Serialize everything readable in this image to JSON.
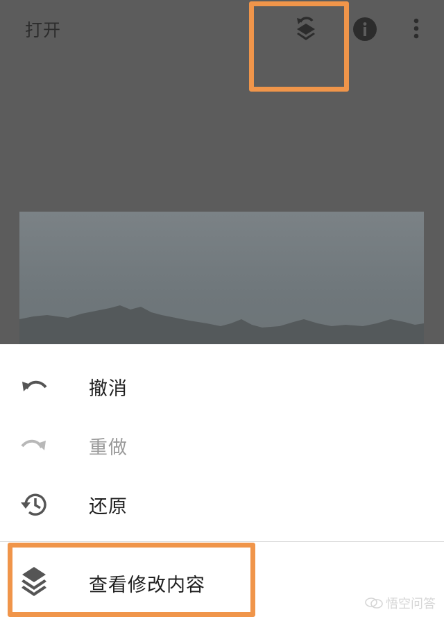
{
  "topbar": {
    "open_label": "打开",
    "icons": [
      "layers-history-icon",
      "info-icon",
      "more-vert-icon"
    ]
  },
  "menu": {
    "items": [
      {
        "label": "撤消",
        "icon": "undo-icon",
        "enabled": true
      },
      {
        "label": "重做",
        "icon": "redo-icon",
        "enabled": false
      },
      {
        "label": "还原",
        "icon": "history-icon",
        "enabled": true
      },
      {
        "label": "查看修改内容",
        "icon": "layers-icon",
        "enabled": true
      }
    ]
  },
  "watermark": {
    "text": "悟空问答"
  },
  "colors": {
    "highlight": "#f0954a",
    "overlay": "#5c5c5c",
    "sheet": "#ffffff"
  }
}
